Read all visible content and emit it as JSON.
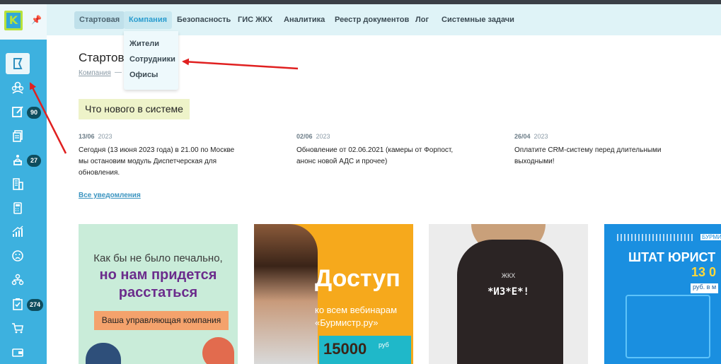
{
  "sidebar": {
    "logo_letter": "K",
    "pin_icon": "pin-icon",
    "items": [
      {
        "icon": "flag-icon",
        "active": true
      },
      {
        "icon": "residents-icon"
      },
      {
        "icon": "tasks-edit-icon",
        "badge": "90"
      },
      {
        "icon": "documents-icon"
      },
      {
        "icon": "dispatcher-icon",
        "badge": "27"
      },
      {
        "icon": "building-icon"
      },
      {
        "icon": "calculator-icon"
      },
      {
        "icon": "chart-growth-icon"
      },
      {
        "icon": "sad-face-icon"
      },
      {
        "icon": "org-structure-icon"
      },
      {
        "icon": "checklist-icon",
        "badge": "274"
      },
      {
        "icon": "cart-icon"
      },
      {
        "icon": "wallet-icon"
      }
    ]
  },
  "topnav": {
    "items": [
      "Стартовая",
      "Компания",
      "Безопасность",
      "ГИС ЖКХ",
      "Аналитика",
      "Реестр документов",
      "Лог",
      "Системные задачи"
    ]
  },
  "dropdown": {
    "items": [
      "Жители",
      "Сотрудники",
      "Офисы"
    ]
  },
  "page": {
    "title": "Стартова",
    "breadcrumb": "Компания",
    "breadcrumb_sep": "—"
  },
  "news": {
    "heading": "Что нового в системе",
    "items": [
      {
        "day": "13/06",
        "year": "2023",
        "text": "Сегодня (13 июня 2023 года) в 21.00 по Москве мы остановим модуль Диспетчерская для обновления."
      },
      {
        "day": "02/06",
        "year": "2023",
        "text": "Обновление от 02.06.2021 (камеры от Форпост, анонс новой АДС и прочее)"
      },
      {
        "day": "26/04",
        "year": "2023",
        "text": "Оплатите CRM-систему перед длительными выходными!"
      }
    ],
    "all_link": "Все уведомления"
  },
  "banners": {
    "b1": {
      "line1": "Как бы не было печально,",
      "line2": "но нам придется",
      "line3": "расстаться",
      "button": "Ваша управляющая компания"
    },
    "b2": {
      "title": "Доступ",
      "sub1": "ко всем вебинарам",
      "sub2": "«Бурмистр.ру»",
      "price": "15000",
      "unit": "руб"
    },
    "b3": {
      "logo": "ЖКХ",
      "phrase": "*ИЗ*Е*!"
    },
    "b4": {
      "brand": "БУРМИ",
      "title": "ШТАТ ЮРИСТ",
      "number": "13 0",
      "note": "руб. в м"
    }
  },
  "colors": {
    "sidebar": "#3db1df",
    "topnav": "#dff3f7",
    "badge": "#0e4d5e",
    "accent": "#2a9dcf",
    "annotation_arrow": "#e02020"
  }
}
